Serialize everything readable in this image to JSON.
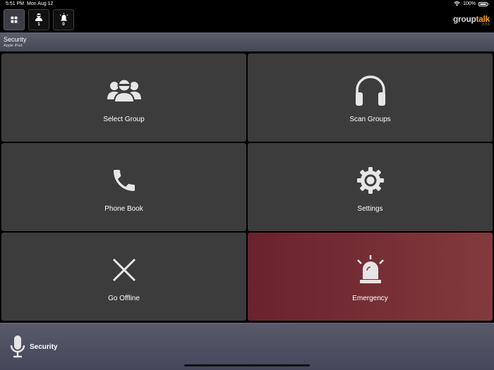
{
  "status_bar": {
    "time": "5:51 PM",
    "date": "Mon Aug 12",
    "battery": "100%"
  },
  "toolbar": {
    "contacts_count": "1",
    "alerts_count": "0"
  },
  "logo": {
    "part1": "group",
    "part2": "talk",
    "version": "3.3.6"
  },
  "header": {
    "title": "Security",
    "subtitle": "Apple iPad"
  },
  "tiles": [
    {
      "label": "Select Group"
    },
    {
      "label": "Scan Groups"
    },
    {
      "label": "Phone Book"
    },
    {
      "label": "Settings"
    },
    {
      "label": "Go Offline"
    },
    {
      "label": "Emergency"
    }
  ],
  "ptt": {
    "group_name": "Security"
  },
  "colors": {
    "accent": "#f7a21b",
    "emergency": "#7a2e35",
    "tile": "#3c3c3c"
  }
}
